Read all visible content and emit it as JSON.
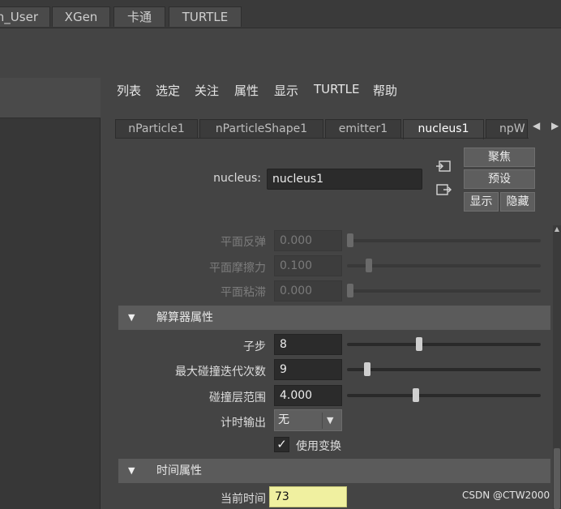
{
  "shelf": {
    "tabs": [
      "n_User",
      "XGen",
      "卡通",
      "TURTLE"
    ]
  },
  "menu": {
    "items": [
      "列表",
      "选定",
      "关注",
      "属性",
      "显示",
      "TURTLE",
      "帮助"
    ]
  },
  "node_tabs": {
    "items": [
      "nParticle1",
      "nParticleShape1",
      "emitter1",
      "nucleus1",
      "npW"
    ],
    "active": "nucleus1"
  },
  "node": {
    "label": "nucleus:",
    "name": "nucleus1"
  },
  "buttons": {
    "focus": "聚焦",
    "presets": "预设",
    "show": "显示",
    "hide": "隐藏"
  },
  "plane_attrs": [
    {
      "label": "平面反弹",
      "value": "0.000",
      "slider": 0.0
    },
    {
      "label": "平面摩擦力",
      "value": "0.100",
      "slider": 0.1
    },
    {
      "label": "平面粘滞",
      "value": "0.000",
      "slider": 0.0
    }
  ],
  "solver_section": {
    "title": "解算器属性",
    "substeps": {
      "label": "子步",
      "value": "8",
      "slider": 0.37
    },
    "max_iterations": {
      "label": "最大碰撞迭代次数",
      "value": "9",
      "slider": 0.09
    },
    "collision_layer": {
      "label": "碰撞层范围",
      "value": "4.000",
      "slider": 0.35
    },
    "timing_output": {
      "label": "计时输出",
      "value": "无"
    },
    "use_transform": {
      "label": "使用变换",
      "checked": true
    }
  },
  "time_section": {
    "title": "时间属性",
    "current_time": {
      "label": "当前时间",
      "value": "73"
    }
  },
  "watermark": "CSDN @CTW2000",
  "colors": {
    "background": "#444444",
    "field": "#2b2b2b",
    "section_header": "#5b5b5b",
    "keyframe_field": "#f0f0a0"
  }
}
